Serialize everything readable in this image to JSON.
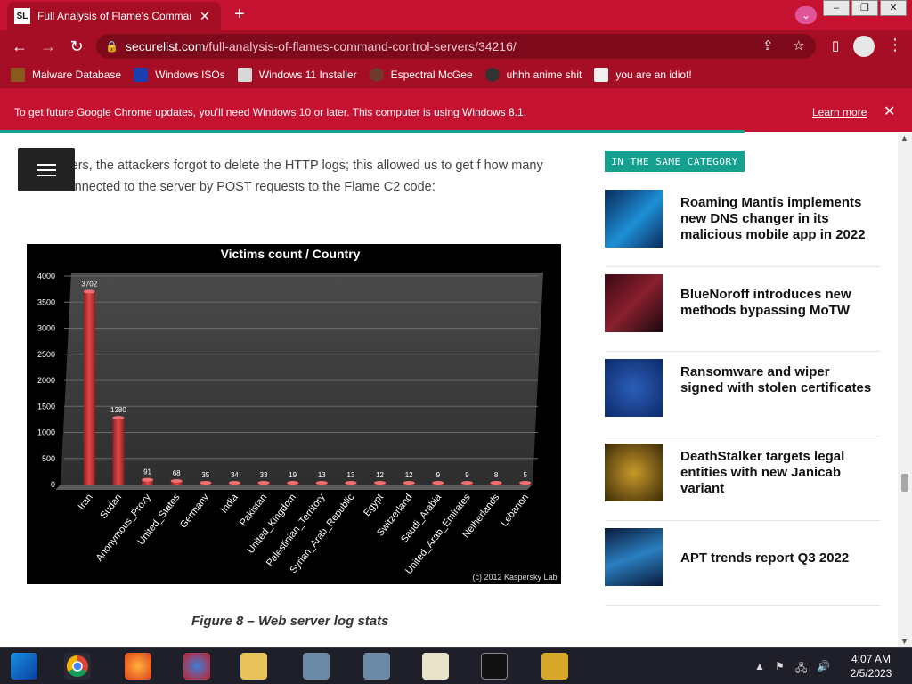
{
  "browser": {
    "tab_title": "Full Analysis of Flame's Command",
    "tab_favicon_text": "SL",
    "url_host": "securelist.com",
    "url_path": "/full-analysis-of-flames-command-control-servers/34216/",
    "bookmarks": [
      {
        "label": "Malware Database",
        "icon": "biohazard-icon"
      },
      {
        "label": "Windows ISOs",
        "icon": "x-icon"
      },
      {
        "label": "Windows 11 Installer",
        "icon": "installer-icon"
      },
      {
        "label": "Espectral McGee",
        "icon": "avatar-icon"
      },
      {
        "label": "uhhh anime shit",
        "icon": "anime-icon"
      },
      {
        "label": "you are an idiot!",
        "icon": "smiley-icon"
      }
    ],
    "infobar_text": "To get future Google Chrome updates, you'll need Windows 10 or later. This computer is using Windows 8.1.",
    "infobar_link": "Learn more",
    "accent": "#c41230"
  },
  "article": {
    "paragraph": "f the servers, the attackers forgot to delete the HTTP logs; this allowed us to get f how many victims connected to the server by POST requests to the Flame C2 code:",
    "caption": "Figure 8 – Web server log stats"
  },
  "chart_data": {
    "type": "bar",
    "title": "Victims count / Country",
    "categories": [
      "Iran",
      "Sudan",
      "Anonymous_Proxy",
      "United_States",
      "Germany",
      "India",
      "Pakistan",
      "United_Kingdom",
      "Palestinian_Territory",
      "Syrian_Arab_Republic",
      "Egypt",
      "Switzerland",
      "Saudi_Arabia",
      "United_Arab_Emirates",
      "Netherlands",
      "Lebanon"
    ],
    "values": [
      3702,
      1280,
      91,
      68,
      35,
      34,
      33,
      19,
      13,
      13,
      12,
      12,
      9,
      9,
      8,
      5
    ],
    "value_labels": [
      "3702",
      "1280",
      "91",
      "68",
      "35",
      "34",
      "33",
      "19",
      "13",
      "13",
      "12",
      "12",
      "9",
      "9",
      "8",
      "5"
    ],
    "yticks": [
      0,
      500,
      1000,
      1500,
      2000,
      2500,
      3000,
      3500,
      4000
    ],
    "ylim": [
      0,
      4000
    ],
    "credit": "(c) 2012 Kaspersky Lab",
    "bar_color": "#d9393a",
    "grid": true
  },
  "sidebar": {
    "category_label": "IN THE SAME CATEGORY",
    "articles": [
      {
        "title": "Roaming Mantis implements new DNS changer in its malicious mobile app in 2022",
        "thumb": "blue-network-thumb"
      },
      {
        "title": "BlueNoroff introduces new methods bypassing MoTW",
        "thumb": "code-thumb"
      },
      {
        "title": "Ransomware and wiper signed with stolen certificates",
        "thumb": "checkmark-thumb"
      },
      {
        "title": "DeathStalker targets legal entities with new Janicab variant",
        "thumb": "circuit-thumb"
      },
      {
        "title": "APT trends report Q3 2022",
        "thumb": "binary-thumb"
      }
    ]
  },
  "taskbar": {
    "time": "4:07 AM",
    "date": "2/5/2023"
  }
}
